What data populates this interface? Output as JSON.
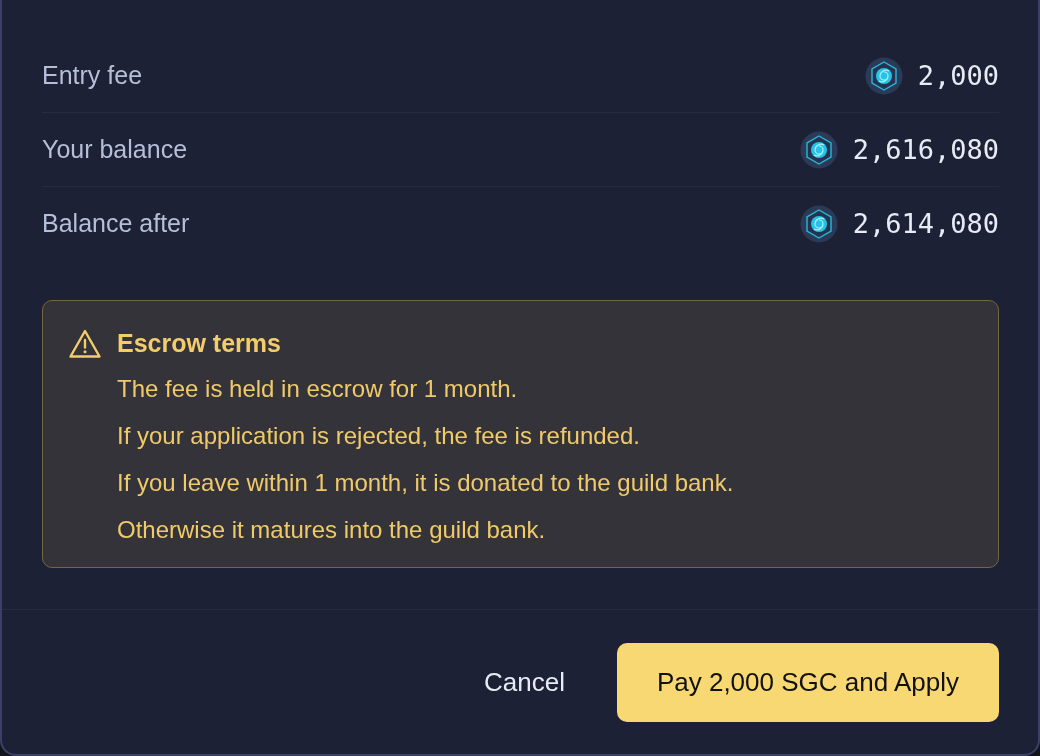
{
  "summary": [
    {
      "label": "Entry fee",
      "amount": "2,000"
    },
    {
      "label": "Your balance",
      "amount": "2,616,080"
    },
    {
      "label": "Balance after",
      "amount": "2,614,080"
    }
  ],
  "notice": {
    "title": "Escrow terms",
    "lines": [
      "The fee is held in escrow for 1 month.",
      "If your application is rejected, the fee is refunded.",
      "If you leave within 1 month, it is donated to the guild bank.",
      "Otherwise it matures into the guild bank."
    ]
  },
  "buttons": [
    {
      "label": "Cancel",
      "kind": "secondary"
    },
    {
      "label": "Pay 2,000 SGC and Apply",
      "kind": "primary"
    }
  ]
}
